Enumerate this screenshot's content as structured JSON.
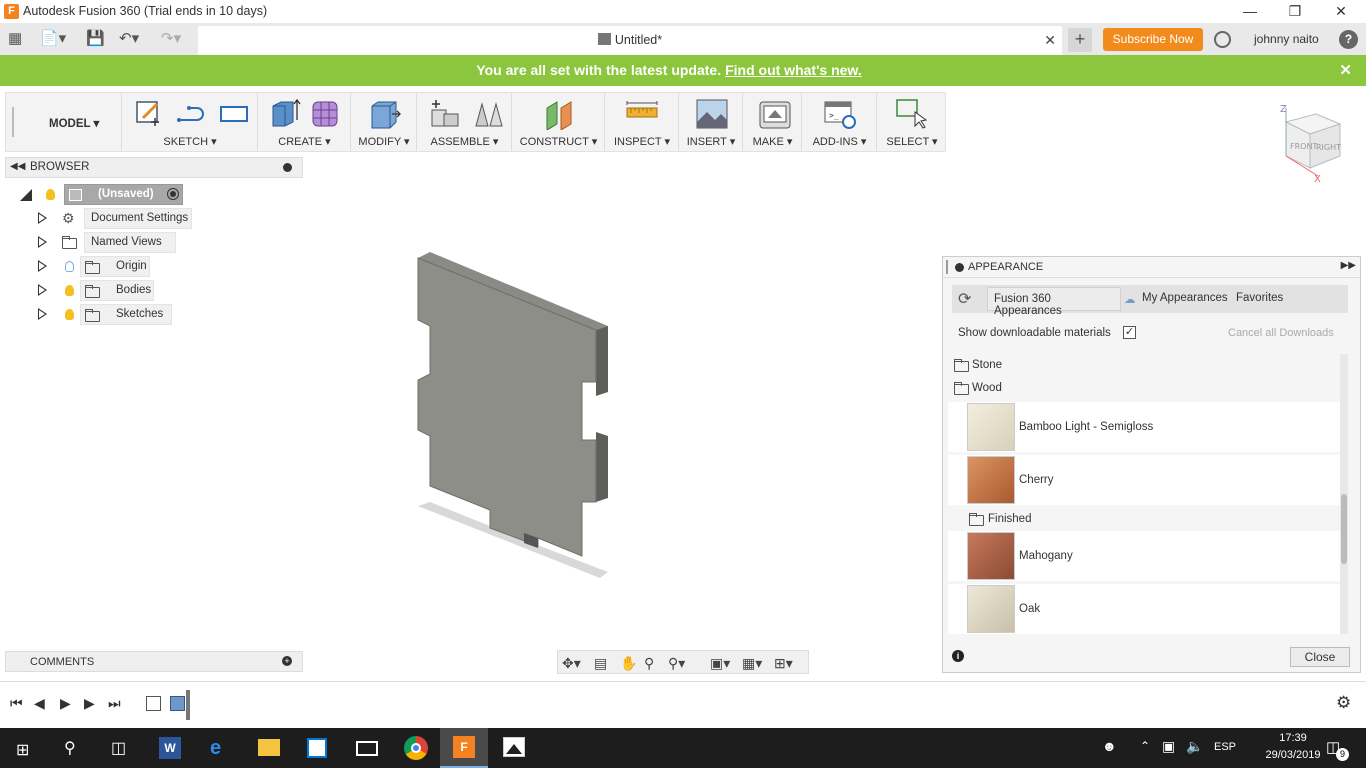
{
  "app": {
    "title": "Autodesk Fusion 360 (Trial ends in 10 days)",
    "logo_letter": "F"
  },
  "tab": {
    "title": "Untitled*"
  },
  "header": {
    "subscribe_label": "Subscribe Now",
    "user_name": "johnny naito",
    "help_label": "?"
  },
  "banner": {
    "message": "You are all set with the latest update.",
    "link": "Find out what's new."
  },
  "toolbar": {
    "workspace": "MODEL",
    "groups": [
      "SKETCH",
      "CREATE",
      "MODIFY",
      "ASSEMBLE",
      "CONSTRUCT",
      "INSPECT",
      "INSERT",
      "MAKE",
      "ADD-INS",
      "SELECT"
    ]
  },
  "browser": {
    "title": "BROWSER",
    "root": "(Unsaved)",
    "items": [
      "Document Settings",
      "Named Views",
      "Origin",
      "Bodies",
      "Sketches"
    ]
  },
  "comments": {
    "title": "COMMENTS"
  },
  "viewcube": {
    "front": "FRONT",
    "right": "RIGHT",
    "z": "Z",
    "x": "X"
  },
  "appearance": {
    "title": "APPEARANCE",
    "tabs": [
      "Fusion 360 Appearances",
      "My Appearances",
      "Favorites"
    ],
    "show_downloadable": "Show downloadable materials",
    "cancel_downloads": "Cancel all Downloads",
    "folders": [
      "Stone",
      "Wood"
    ],
    "materials": [
      "Bamboo Light - Semigloss",
      "Cherry",
      "Mahogany",
      "Oak"
    ],
    "subfolder": "Finished",
    "close_label": "Close",
    "colors": {
      "bamboo": "#e8e2cf",
      "cherry": "#c97b4a",
      "mahogany": "#b0644a",
      "oak": "#ddd6c3"
    }
  },
  "taskbar": {
    "language": "ESP",
    "time": "17:39",
    "date": "29/03/2019",
    "notifications": "9"
  }
}
